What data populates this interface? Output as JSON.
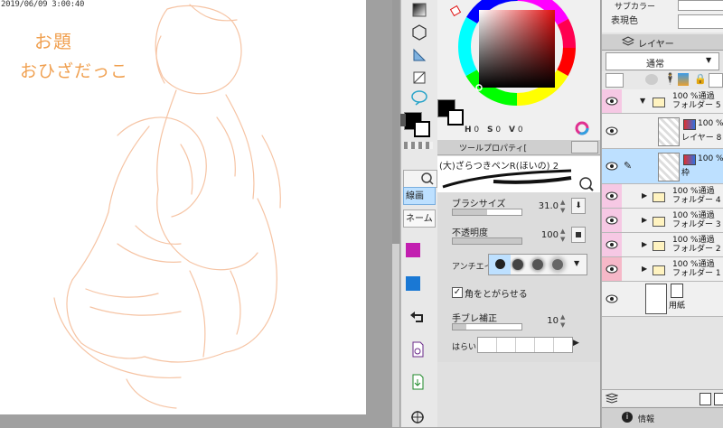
{
  "canvas": {
    "timestamp": "2019/06/09 3:00:40",
    "theme_line1": "お題",
    "theme_line2": "おひざだっこ"
  },
  "toolbar": {
    "tabs": [
      {
        "label": "線画"
      },
      {
        "label": "ネーム"
      }
    ],
    "tool_icons": [
      "gradient-icon",
      "polygon-icon",
      "ruler-icon",
      "frame-icon",
      "lasso-fill-icon"
    ],
    "palette_colors": {
      "magenta": "#c21fb0",
      "blue": "#1a78d4"
    }
  },
  "color": {
    "hsv_h": "H",
    "hsv_h_val": "0",
    "hsv_s": "S",
    "hsv_s_val": "0",
    "hsv_v": "V",
    "hsv_v_val": "0"
  },
  "tool_property": {
    "tab_label": "ツールプロパティ[",
    "brush_name": "(大)ざらつきペンR(ほいの) 2",
    "brush_size_label": "ブラシサイズ",
    "brush_size_value": "31.0",
    "opacity_label": "不透明度",
    "opacity_value": "100",
    "antialias_label": "アンチエイリ",
    "sharp_corner_label": "角をとがらせる",
    "stabilizer_label": "手ブレ補正",
    "stabilizer_value": "10",
    "harai_label": "はらい"
  },
  "layer_panel": {
    "sub_color_label": "サブカラー",
    "expression_label": "表現色",
    "tab_label": "レイヤー",
    "blend_mode": "通常",
    "layers": [
      {
        "line1": "100 %通過",
        "line2": "フォルダー 5"
      },
      {
        "line1": "100 %",
        "line2": "レイヤー 8"
      },
      {
        "line1": "100 %",
        "line2": "枠"
      },
      {
        "line1": "100 %通過",
        "line2": "フォルダー 4"
      },
      {
        "line1": "100 %通過",
        "line2": "フォルダー 3"
      },
      {
        "line1": "100 %通過",
        "line2": "フォルダー 2"
      },
      {
        "line1": "100 %通過",
        "line2": "フォルダー 1"
      },
      {
        "line1": "",
        "line2": "用紙"
      }
    ],
    "info_tab": "情報"
  }
}
